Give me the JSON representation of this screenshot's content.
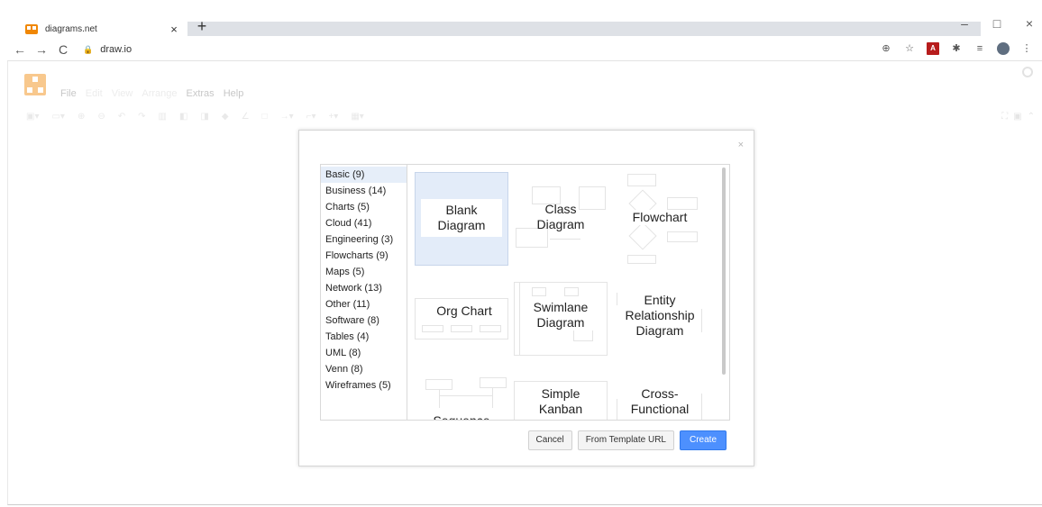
{
  "browser": {
    "tab_title": "diagrams.net",
    "tab_close": "×",
    "new_tab": "+",
    "win_min": "–",
    "win_max": "□",
    "win_close": "×",
    "back": "←",
    "forward": "→",
    "reload": "C",
    "url": "draw.io",
    "menu_dots": "⋮"
  },
  "app": {
    "menu": [
      "File",
      "Edit",
      "View",
      "Arrange",
      "Extras",
      "Help"
    ]
  },
  "dialog": {
    "close": "×",
    "categories": [
      {
        "label": "Basic (9)",
        "selected": true
      },
      {
        "label": "Business (14)"
      },
      {
        "label": "Charts (5)"
      },
      {
        "label": "Cloud (41)"
      },
      {
        "label": "Engineering (3)"
      },
      {
        "label": "Flowcharts (9)"
      },
      {
        "label": "Maps (5)"
      },
      {
        "label": "Network (13)"
      },
      {
        "label": "Other (11)"
      },
      {
        "label": "Software (8)"
      },
      {
        "label": "Tables (4)"
      },
      {
        "label": "UML (8)"
      },
      {
        "label": "Venn (8)"
      },
      {
        "label": "Wireframes (5)"
      }
    ],
    "templates": [
      {
        "title": "Blank\nDiagram",
        "selected": true
      },
      {
        "title": "Class\nDiagram"
      },
      {
        "title": "Flowchart"
      },
      {
        "title": "Org Chart"
      },
      {
        "title": "Swimlane\nDiagram"
      },
      {
        "title": "Entity\nRelationship\nDiagram"
      },
      {
        "title": "Sequence"
      },
      {
        "title": "Simple\nKanban"
      },
      {
        "title": "Cross-\nFunctional"
      }
    ],
    "buttons": {
      "cancel": "Cancel",
      "from_url": "From Template URL",
      "create": "Create"
    }
  }
}
